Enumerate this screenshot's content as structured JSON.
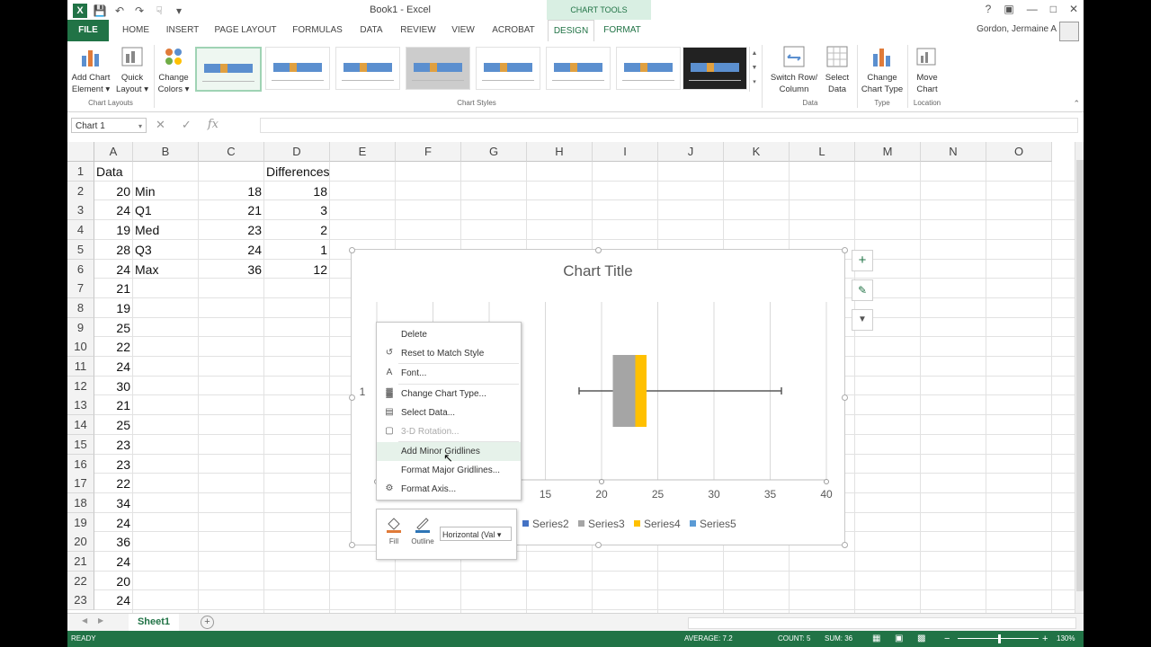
{
  "window": {
    "title": "Book1 - Excel",
    "chart_tools_label": "CHART TOOLS",
    "user_name": "Gordon, Jermaine A"
  },
  "ribbon_tabs": [
    "FILE",
    "HOME",
    "INSERT",
    "PAGE LAYOUT",
    "FORMULAS",
    "DATA",
    "REVIEW",
    "VIEW",
    "ACROBAT",
    "DESIGN",
    "FORMAT"
  ],
  "ribbon": {
    "add_chart_element": [
      "Add Chart",
      "Element ▾"
    ],
    "quick_layout": [
      "Quick",
      "Layout ▾"
    ],
    "change_colors": [
      "Change",
      "Colors ▾"
    ],
    "switch_row_column": [
      "Switch Row/",
      "Column"
    ],
    "select_data": [
      "Select",
      "Data"
    ],
    "change_chart_type": [
      "Change",
      "Chart Type"
    ],
    "move_chart": [
      "Move",
      "Chart"
    ],
    "groups": {
      "chart_layouts": "Chart Layouts",
      "chart_styles": "Chart Styles",
      "data": "Data",
      "type": "Type",
      "location": "Location"
    }
  },
  "formula_bar": {
    "name_box": "Chart 1",
    "cancel": "✕",
    "enter": "✓",
    "fx": "fx",
    "value": ""
  },
  "columns": [
    "A",
    "B",
    "C",
    "D",
    "E",
    "F",
    "G",
    "H",
    "I",
    "J",
    "K",
    "L",
    "M",
    "N",
    "O"
  ],
  "rows": [
    "1",
    "2",
    "3",
    "4",
    "5",
    "6",
    "7",
    "8",
    "9",
    "10",
    "11",
    "12",
    "13",
    "14",
    "15",
    "16",
    "17",
    "18",
    "19",
    "20",
    "21",
    "22",
    "23"
  ],
  "cells": {
    "A": [
      "Data",
      "20",
      "24",
      "19",
      "28",
      "24",
      "21",
      "19",
      "25",
      "22",
      "24",
      "30",
      "21",
      "25",
      "23",
      "23",
      "22",
      "34",
      "24",
      "36",
      "24",
      "20",
      "24"
    ],
    "B": [
      "",
      "Min",
      "Q1",
      "Med",
      "Q3",
      "Max"
    ],
    "C": [
      "",
      "18",
      "21",
      "23",
      "24",
      "36"
    ],
    "D": [
      "Differences",
      "18",
      "3",
      "2",
      "1",
      "12"
    ]
  },
  "chart": {
    "title": "Chart Title",
    "side_buttons": {
      "elements": "+",
      "styles": "✎",
      "filters": "▼"
    },
    "legend": [
      "Series2",
      "Series3",
      "Series4",
      "Series5"
    ],
    "legend_colors": [
      "#4472c4",
      "#a5a5a5",
      "#ffc000",
      "#5b9bd5"
    ],
    "x_ticks": [
      "15",
      "20",
      "25",
      "30",
      "35",
      "40"
    ],
    "y_label": "1"
  },
  "chart_data": {
    "type": "bar",
    "orientation": "horizontal-stacked",
    "title": "Chart Title",
    "categories": [
      "1"
    ],
    "series": [
      {
        "name": "Series2",
        "values": [
          3
        ],
        "color": "#a5a5a5"
      },
      {
        "name": "Series4",
        "values": [
          1
        ],
        "color": "#ffc000"
      }
    ],
    "whisker": {
      "min": 18,
      "box_start": 21,
      "median": 23,
      "box_end": 24,
      "max": 36
    },
    "xlim": [
      0,
      40
    ],
    "x_ticks": [
      15,
      20,
      25,
      30,
      35,
      40
    ],
    "grid": true,
    "legend_position": "bottom"
  },
  "context_menu": {
    "items": [
      {
        "label": "Delete",
        "icon": "",
        "state": "normal"
      },
      {
        "label": "Reset to Match Style",
        "icon": "reset-icon",
        "state": "normal"
      },
      {
        "label": "Font...",
        "icon": "font-icon",
        "state": "normal"
      },
      {
        "label": "Change Chart Type...",
        "icon": "chart-type-icon",
        "state": "normal"
      },
      {
        "label": "Select Data...",
        "icon": "select-data-icon",
        "state": "normal"
      },
      {
        "label": "3-D Rotation...",
        "icon": "rotation-icon",
        "state": "disabled"
      },
      {
        "label": "Add Minor Gridlines",
        "icon": "",
        "state": "highlighted"
      },
      {
        "label": "Format Major Gridlines...",
        "icon": "",
        "state": "normal"
      },
      {
        "label": "Format Axis...",
        "icon": "format-axis-icon",
        "state": "normal"
      }
    ]
  },
  "mini_toolbar": {
    "fill": "Fill",
    "outline": "Outline",
    "selector": "Horizontal (Val ▾"
  },
  "sheet_tabs": [
    "Sheet1"
  ],
  "status": {
    "ready": "READY",
    "average": "AVERAGE: 7.2",
    "count": "COUNT: 5",
    "sum": "SUM: 36",
    "zoom": "130%"
  }
}
